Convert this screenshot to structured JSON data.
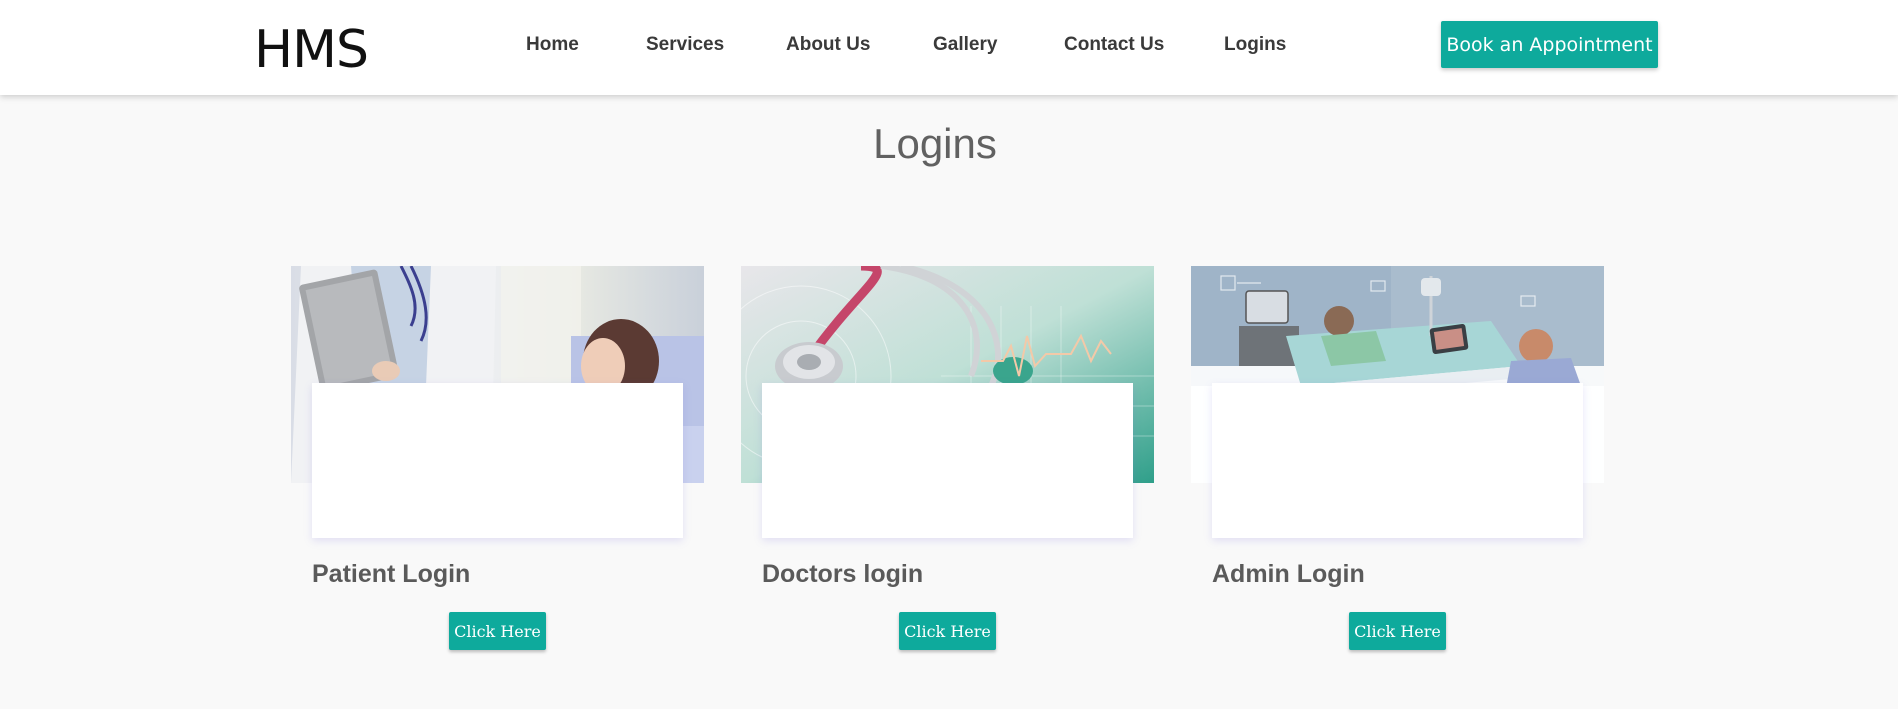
{
  "brand": {
    "logo_text": "HMS"
  },
  "nav": {
    "items": [
      {
        "label": "Home"
      },
      {
        "label": "Services"
      },
      {
        "label": "About Us"
      },
      {
        "label": "Gallery"
      },
      {
        "label": "Contact Us"
      },
      {
        "label": "Logins"
      }
    ],
    "cta_label": "Book an Appointment"
  },
  "page": {
    "title": "Logins"
  },
  "cards": [
    {
      "title": "Patient Login",
      "button_label": "Click Here",
      "image": "doctor-patient-photo"
    },
    {
      "title": "Doctors login",
      "button_label": "Click Here",
      "image": "stethoscope-photo"
    },
    {
      "title": "Admin Login",
      "button_label": "Click Here",
      "image": "hospital-ward-illustration"
    }
  ],
  "colors": {
    "accent": "#0eaa9c",
    "background": "#f9f9f9",
    "header_bg": "#ffffff",
    "title_text": "#616161",
    "card_title_text": "#5a5a5a",
    "nav_text": "#3a3a3a"
  }
}
